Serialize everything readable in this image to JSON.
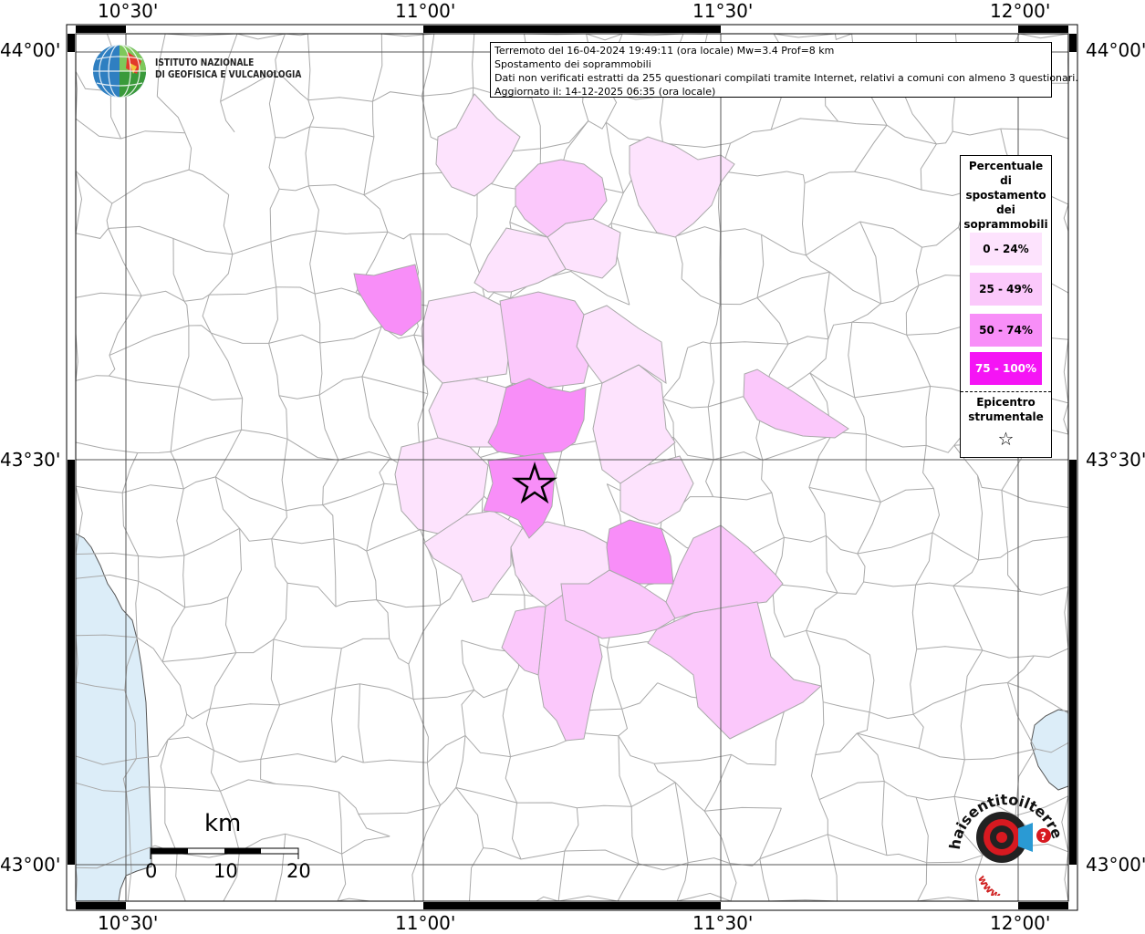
{
  "axes": {
    "top_labels": [
      "10°30'",
      "11°00'",
      "11°30'",
      "12°00'"
    ],
    "bottom_labels": [
      "10°30'",
      "11°00'",
      "11°30'",
      "12°00'"
    ],
    "left_labels": [
      "44°00'",
      "43°30'",
      "43°00'"
    ],
    "right_labels": [
      "44°00'",
      "43°30'",
      "43°00'"
    ]
  },
  "logo": {
    "name": "ingv-globe-logo",
    "line1": "ISTITUTO NAZIONALE",
    "line2": "DI GEOFISICA E VULCANOLOGIA"
  },
  "info": {
    "line1": "Terremoto del 16-04-2024 19:49:11 (ora locale) Mw=3.4 Prof=8 km",
    "line2": "Spostamento dei soprammobili",
    "line3": "Dati non verificati estratti da 255 questionari compilati tramite Internet, relativi a comuni con almeno 3 questionari.",
    "line4": "Aggiornato il: 14-12-2025 06:35 (ora locale)"
  },
  "legend": {
    "title_lines": [
      "Percentuale",
      "di",
      "spostamento",
      "dei",
      "soprammobili"
    ],
    "classes": [
      {
        "label": "0 - 24%",
        "color": "#fde3fd"
      },
      {
        "label": "25 - 49%",
        "color": "#fbc8fb"
      },
      {
        "label": "50 - 74%",
        "color": "#f88ef8"
      },
      {
        "label": "75 - 100%",
        "color": "#f514f5"
      }
    ],
    "epicenter_lines": [
      "Epicentro",
      "strumentale"
    ],
    "epicenter_symbol": "☆"
  },
  "scale": {
    "unit": "km",
    "labels": [
      "0",
      "10",
      "20"
    ]
  },
  "colors": {
    "sea": "#dcedf8",
    "municipal_border": "#a9a9a9",
    "graticule": "#555555",
    "frame": "#000000"
  },
  "watermark": {
    "name": "haisentitoilterremoto-logo",
    "text": "haisentitoilterremoto.it",
    "www": "www."
  }
}
